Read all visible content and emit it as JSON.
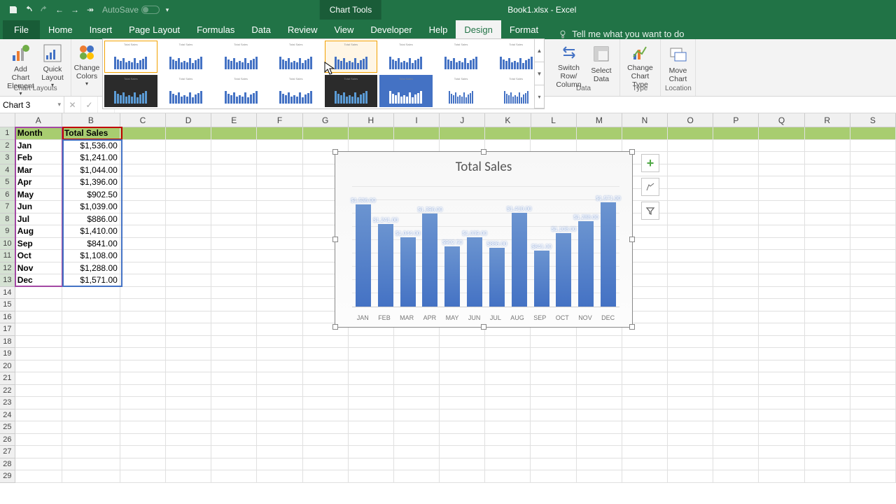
{
  "titlebar": {
    "autosave_label": "AutoSave",
    "chart_tools": "Chart Tools",
    "doc": "Book1.xlsx - Excel"
  },
  "tabs": {
    "file": "File",
    "home": "Home",
    "insert": "Insert",
    "page_layout": "Page Layout",
    "formulas": "Formulas",
    "data": "Data",
    "review": "Review",
    "view": "View",
    "developer": "Developer",
    "help": "Help",
    "design": "Design",
    "format": "Format",
    "tellme": "Tell me what you want to do"
  },
  "ribbon": {
    "add_chart_element": "Add Chart\nElement",
    "quick_layout": "Quick\nLayout",
    "change_colors": "Change\nColors",
    "switch": "Switch Row/\nColumn",
    "select_data": "Select\nData",
    "change_type": "Change\nChart Type",
    "move_chart": "Move\nChart",
    "g_layouts": "Chart Layouts",
    "g_data": "Data",
    "g_type": "Type",
    "g_location": "Location"
  },
  "namebox": "Chart 3",
  "columns": [
    "A",
    "B",
    "C",
    "D",
    "E",
    "F",
    "G",
    "H",
    "I",
    "J",
    "K",
    "L",
    "M",
    "N",
    "O",
    "P",
    "Q",
    "R",
    "S"
  ],
  "headers": {
    "month": "Month",
    "total": "Total Sales"
  },
  "table": [
    {
      "m": "Jan",
      "v": "$1,536.00",
      "n": 1536
    },
    {
      "m": "Feb",
      "v": "$1,241.00",
      "n": 1241
    },
    {
      "m": "Mar",
      "v": "$1,044.00",
      "n": 1044
    },
    {
      "m": "Apr",
      "v": "$1,396.00",
      "n": 1396
    },
    {
      "m": "May",
      "v": "$902.50",
      "n": 902.5
    },
    {
      "m": "Jun",
      "v": "$1,039.00",
      "n": 1039
    },
    {
      "m": "Jul",
      "v": "$886.00",
      "n": 886
    },
    {
      "m": "Aug",
      "v": "$1,410.00",
      "n": 1410
    },
    {
      "m": "Sep",
      "v": "$841.00",
      "n": 841
    },
    {
      "m": "Oct",
      "v": "$1,108.00",
      "n": 1108
    },
    {
      "m": "Nov",
      "v": "$1,288.00",
      "n": 1288
    },
    {
      "m": "Dec",
      "v": "$1,571.00",
      "n": 1571
    }
  ],
  "chart_data": {
    "type": "bar",
    "title": "Total Sales",
    "categories": [
      "JAN",
      "FEB",
      "MAR",
      "APR",
      "MAY",
      "JUN",
      "JUL",
      "AUG",
      "SEP",
      "OCT",
      "NOV",
      "DEC"
    ],
    "values": [
      1536,
      1241,
      1044,
      1396,
      902.5,
      1039,
      886,
      1410,
      841,
      1108,
      1288,
      1571
    ],
    "data_labels": [
      "$1,536.00",
      "$1,241.00",
      "$1,044.00",
      "$1,396.00",
      "$902.50",
      "$1,039.00",
      "$886.00",
      "$1,410.00",
      "$841.00",
      "$1,108.00",
      "$1,288.00",
      "$1,571.00"
    ],
    "ylim": [
      0,
      1800
    ],
    "gridlines": [
      200,
      400,
      600,
      800,
      1000,
      1200,
      1400,
      1600,
      1800
    ]
  }
}
